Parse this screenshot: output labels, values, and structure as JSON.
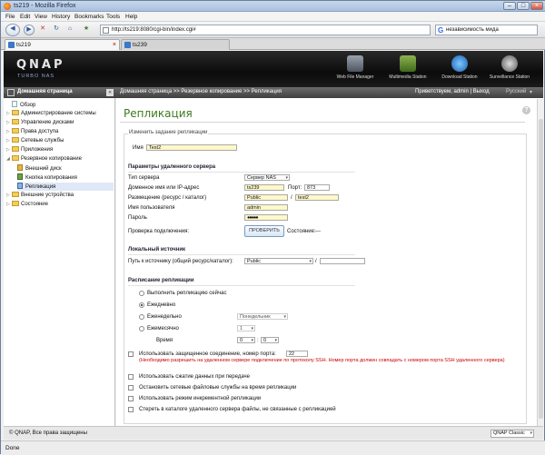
{
  "window": {
    "title": "ts219 - Mozilla Firefox"
  },
  "menu": [
    "File",
    "Edit",
    "View",
    "History",
    "Bookmarks",
    "Tools",
    "Help"
  ],
  "nav": {
    "url": "http://ts219:8080/cgi-bin/index.cgi#",
    "search": "независимость мида"
  },
  "tabs": [
    {
      "label": "ts219"
    },
    {
      "label": "ts239"
    }
  ],
  "qnap": {
    "logo": "QNAP",
    "tagline": "TURBO NAS",
    "apps": [
      "Web File Manager",
      "Multimedia Station",
      "Download Station",
      "Surveillance Station"
    ]
  },
  "crumbs": {
    "home": "Домашняя страница",
    "path": "Домашняя страница >> Резервное копирование >> Репликация",
    "welcome": "Приветствуем, admin | Выход",
    "lang": "Русский"
  },
  "sidebar": [
    {
      "label": "Обзор"
    },
    {
      "label": "Администрирование системы"
    },
    {
      "label": "Управление дисками"
    },
    {
      "label": "Права доступа"
    },
    {
      "label": "Сетевые службы"
    },
    {
      "label": "Приложения"
    },
    {
      "label": "Резервное копирование"
    },
    {
      "label": "Внешний диск"
    },
    {
      "label": "Кнопка копирования"
    },
    {
      "label": "Репликация"
    },
    {
      "label": "Внешние устройства"
    },
    {
      "label": "Состояние"
    }
  ],
  "page": {
    "title": "Репликация",
    "legend": "Изменить задание репликации",
    "name_label": "Имя",
    "name_value": "Test2",
    "remote": {
      "title": "Параметры удаленного сервера",
      "type_label": "Тип сервера",
      "type_value": "Сервер NAS",
      "host_label": "Доменное имя или IP-адрес",
      "host_value": "ts239",
      "port_label": "Порт:",
      "port_value": "873",
      "share_label": "Размещение (ресурс / каталог)",
      "share_value": "Public",
      "share_sep": "/",
      "dir_value": "test2",
      "user_label": "Имя пользователя",
      "user_value": "admin",
      "pass_label": "Пароль",
      "pass_value": "●●●●●",
      "check_label": "Проверка подключения:",
      "check_button": "ПРОВЕРИТЬ",
      "status_label": "Состояние:",
      "status_value": "---"
    },
    "local": {
      "title": "Локальный источник",
      "path_label": "Путь к источнику (общий ресурс/каталог):",
      "path_value": "Public",
      "sep": "/"
    },
    "schedule": {
      "title": "Расписание репликации",
      "opt_now": "Выполнить репликацию сейчас",
      "opt_daily": "Ежедневно",
      "opt_weekly": "Еженедельно",
      "weekly_value": "Понедельник",
      "opt_monthly": "Ежемесячно",
      "monthly_value": "1",
      "time_label": "Время",
      "hour_value": "0",
      "colon": ":",
      "min_value": "0"
    },
    "options": {
      "ssl_label": "Использовать защищенное соединение, номер порта:",
      "ssl_port": "22",
      "ssl_note": "(Необходимо разрешить на удаленном сервере подключение по протоколу SSH. Номер порта должен совпадать с номером порта SSH удаленного сервера)",
      "compress": "Использовать сжатие данных при передаче",
      "stop_services": "Остановить сетевые файловые службы на время репликации",
      "incremental": "Использовать режим инкрементной репликации",
      "delete_extra": "Стереть в каталоге удаленного сервера файлы, не связанные с репликацией"
    }
  },
  "footer": {
    "copyright": "© QNAP, Все права защищены",
    "theme": "QNAP Classic"
  },
  "status": {
    "text": "Done"
  }
}
